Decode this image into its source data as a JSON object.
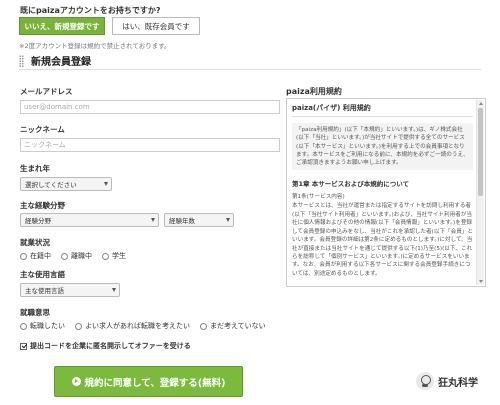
{
  "account_question": {
    "label": "既にpaizaアカウントをお持ちですか?",
    "new_button": "いいえ、新規登録です",
    "existing_button": "はい、既存会員です"
  },
  "note": "※2度アカウント登録は規約で禁止されております。",
  "section_title": "新規会員登録",
  "form": {
    "email": {
      "label": "メールアドレス",
      "placeholder": "user@domain.com"
    },
    "nickname": {
      "label": "ニックネーム",
      "placeholder": "ニックネーム"
    },
    "birth_year": {
      "label": "生まれ年",
      "selected": "選択してください"
    },
    "experience": {
      "label": "主な経験分野",
      "field_selected": "経験分野",
      "years_selected": "経験年数"
    },
    "employment": {
      "label": "就業状況",
      "options": [
        "在籍中",
        "離職中",
        "学生"
      ]
    },
    "language": {
      "label": "主な使用言語",
      "selected": "主な使用言語"
    },
    "job_intent": {
      "label": "就職意思",
      "options": [
        "転職したい",
        "よい求人があれば転職を考えたい",
        "まだ考えていない"
      ]
    },
    "consent_label": "提出コードを企業に匿名開示してオファーを受ける",
    "submit_label": "規約に同意して、登録する(無料)"
  },
  "terms": {
    "title": "paiza利用規約",
    "heading": "paiza(パイザ) 利用規約",
    "intro": "「paiza利用規約」(以下「本規約」といいます。)は、ギノ株式会社(以下「当社」といいます。)が当社サイトで提供する全てのサービス(以下「本サービス」といいます。)を利用する上での会員事項となります。本サービスをご利用になる前に、本規約を必ずご一読のうえ、ご承認頂きますようお願い申し上げます。",
    "chapter": "第1章 本サービスおよび本規約について",
    "article": "第1条(サービス内容)",
    "body": "本サービスとは、当社が運営または指定するサイトを訪問し利用する者(以下「当社サイト利用者」といいます。)および、当社サイト利用者が当社に個人情報およびその他の情報(以下「会員情報」といいます。)を登録して会員登録の申込みをなし、当社がこれを承認した者(以下「会員」といいます。会員登録の詳細は第2条に定めるものとします。)に対して、当社が直接または当社サイトを通じて提供する以下(1)乃至(5)(以下、これらを総称して「個別サービス」といいます。)に定めるサービスをいいます。なお、会員が利用する以下各サービスに関する会員登録手続きについては、別途定めるものとします。"
  },
  "watermark": "狂丸科学"
}
